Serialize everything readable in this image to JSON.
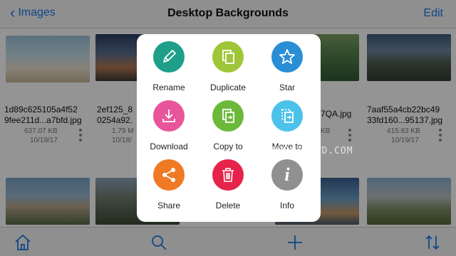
{
  "navbar": {
    "back_label": "Images",
    "title": "Desktop Backgrounds",
    "edit_label": "Edit"
  },
  "files": [
    {
      "name1": "1d89c625105a4f52",
      "name2": "9fee211d...a7bfd.jpg",
      "size": "637.07 KB",
      "date": "10/19/17"
    },
    {
      "name1": "2ef125_8",
      "name2": "0254a92.",
      "size": "1.79 M",
      "date": "10/18/"
    },
    {
      "name1": "",
      "name2": "7QA.jpg",
      "size": "KB",
      "date": ""
    },
    {
      "name1": "7aaf55a4cb22bc49",
      "name2": "33fd160...95137.jpg",
      "size": "415.83 KB",
      "date": "10/19/17"
    }
  ],
  "actions": [
    {
      "label": "Rename",
      "icon": "pencil-icon",
      "color": "#1f9f8a"
    },
    {
      "label": "Duplicate",
      "icon": "duplicate-icon",
      "color": "#9fc639"
    },
    {
      "label": "Star",
      "icon": "star-icon",
      "color": "#2a8ed6"
    },
    {
      "label": "Download",
      "icon": "download-icon",
      "color": "#e8559a"
    },
    {
      "label": "Copy to",
      "icon": "copy-to-icon",
      "color": "#6cb93a"
    },
    {
      "label": "Move to",
      "icon": "move-to-icon",
      "color": "#4cc2ea"
    },
    {
      "label": "Share",
      "icon": "share-icon",
      "color": "#f07a24"
    },
    {
      "label": "Delete",
      "icon": "trash-icon",
      "color": "#e6234a"
    },
    {
      "label": "Info",
      "icon": "info-icon",
      "color": "#909090"
    }
  ],
  "toolbar": {
    "home": "home-icon",
    "search": "search-icon",
    "add": "plus-icon",
    "sort": "sort-icon"
  },
  "watermark": "COMPUTERWD.COM"
}
